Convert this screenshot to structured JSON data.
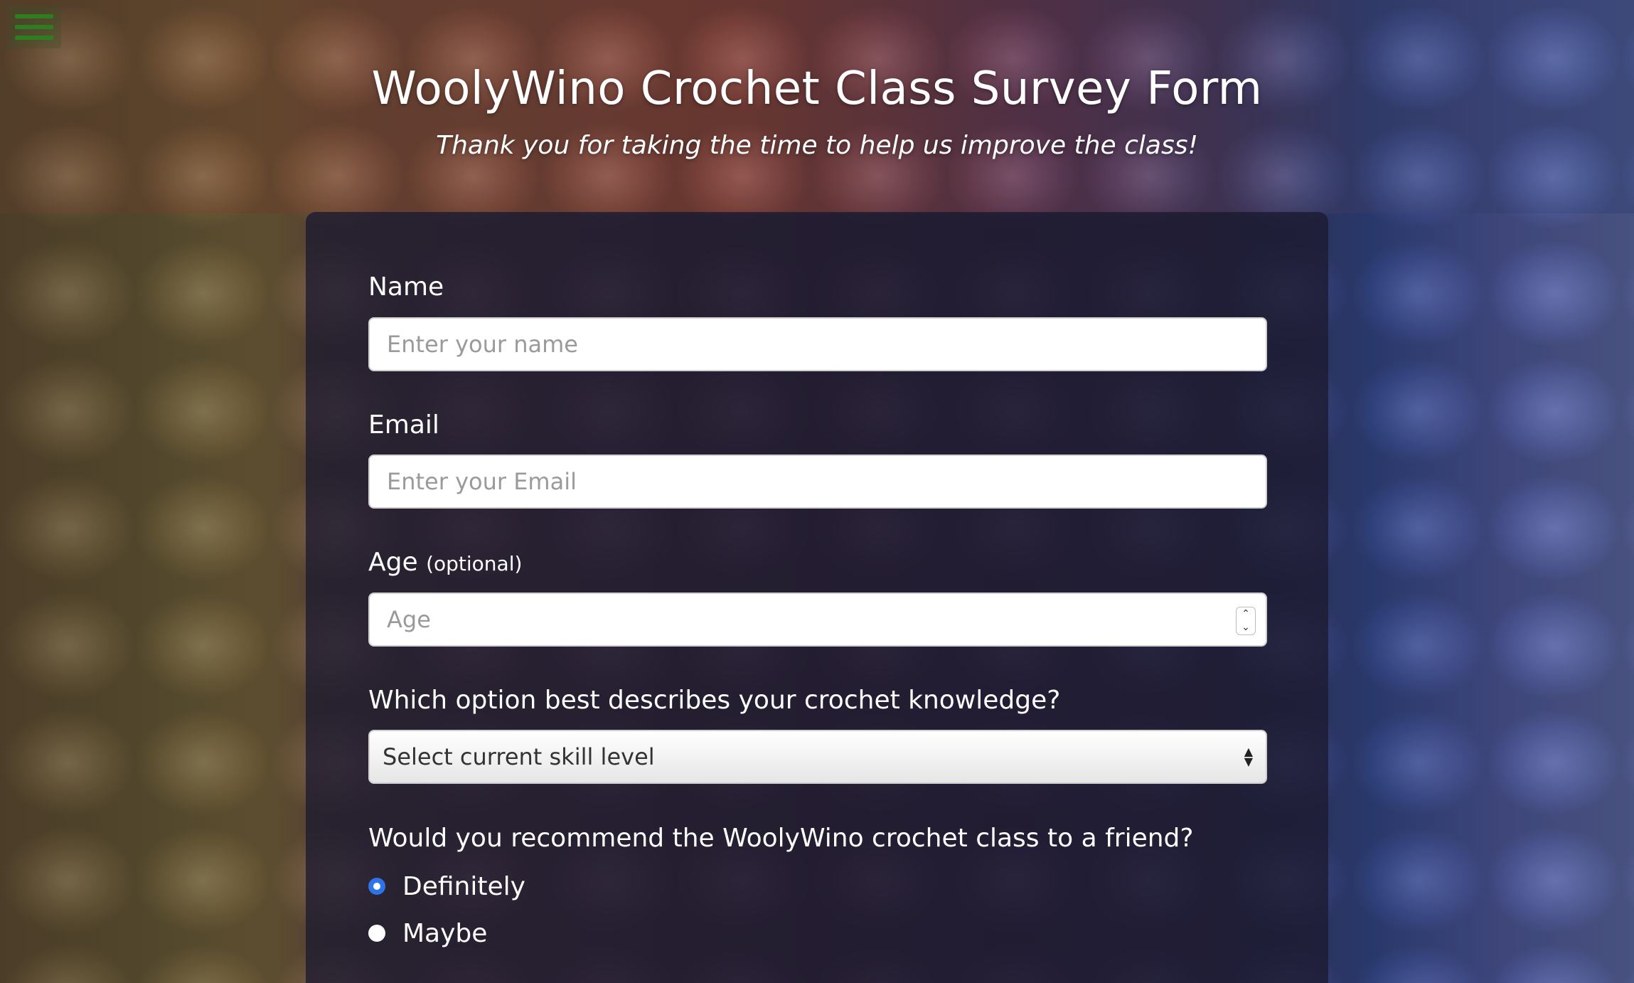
{
  "menu": {
    "icon": "hamburger-menu-icon",
    "color": "#2e7d1e"
  },
  "header": {
    "title": "WoolyWino Crochet Class Survey Form",
    "subtitle": "Thank you for taking the time to help us improve the class!"
  },
  "form": {
    "name": {
      "label": "Name",
      "placeholder": "Enter your name",
      "value": ""
    },
    "email": {
      "label": "Email",
      "placeholder": "Enter your Email",
      "value": ""
    },
    "age": {
      "label": "Age",
      "optional_note": "(optional)",
      "placeholder": "Age",
      "value": ""
    },
    "skill": {
      "label": "Which option best describes your crochet knowledge?",
      "selected": "Select current skill level"
    },
    "recommend": {
      "question": "Would you recommend the WoolyWino crochet class to a friend?",
      "options": [
        {
          "label": "Definitely",
          "checked": true
        },
        {
          "label": "Maybe",
          "checked": false
        }
      ]
    }
  },
  "colors": {
    "radio_checked": "#2f74e6",
    "card_background": "rgba(28,26,48,0.78)",
    "text": "#ffffff"
  }
}
